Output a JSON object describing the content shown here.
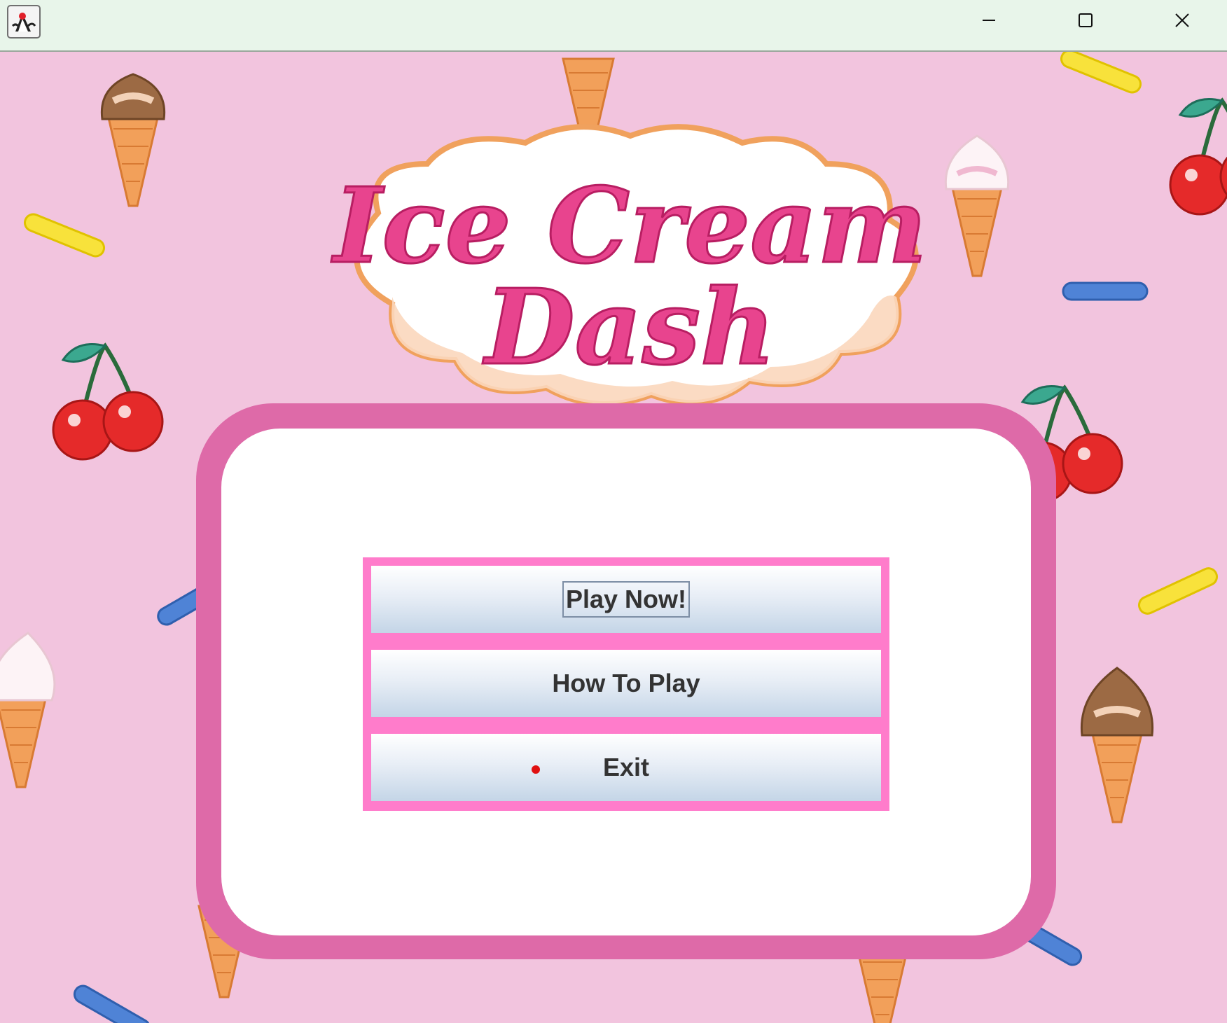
{
  "window": {
    "title": "",
    "controls": [
      "minimize-icon",
      "maximize-icon",
      "close-icon"
    ],
    "app_icon": "java-duke-icon"
  },
  "game": {
    "logo_line1": "Ice Cream",
    "logo_line2": "Dash",
    "background_color": "#f2c4de",
    "decorations": [
      "ice-cream-cone-icon",
      "cherry-icon",
      "sprinkle-icon"
    ]
  },
  "menu": {
    "play_label": "Play Now!",
    "howto_label": "How To Play",
    "exit_label": "Exit",
    "focused_item": "Play Now!",
    "accent_color": "#ff7ccb",
    "frame_color": "#de6aa8"
  }
}
